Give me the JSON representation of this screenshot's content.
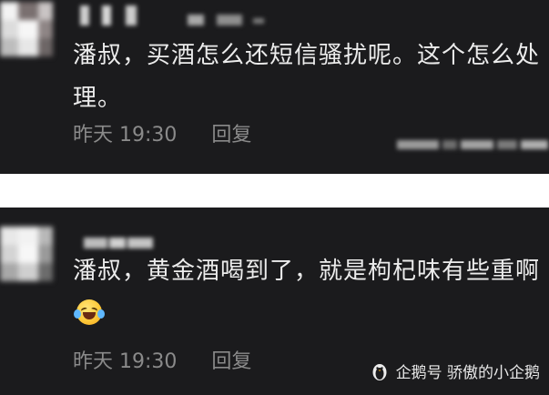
{
  "comments": [
    {
      "text": "潘叔，买酒怎么还短信骚扰呢。这个怎么处理。",
      "time": "昨天 19:30",
      "reply_label": "回复",
      "emoji": ""
    },
    {
      "text": "潘叔，黄金酒喝到了，就是枸杞味有些重啊",
      "time": "昨天 19:30",
      "reply_label": "回复",
      "emoji": "laughing-tears-emoji"
    }
  ],
  "watermark": {
    "text": "企鹅号 骄傲的小企鹅",
    "icon": "penguin-icon"
  },
  "colors": {
    "panel_background": "#1b1b1d",
    "page_background": "#ffffff",
    "comment_text": "#ececec",
    "meta_text": "#8a8a8a"
  }
}
